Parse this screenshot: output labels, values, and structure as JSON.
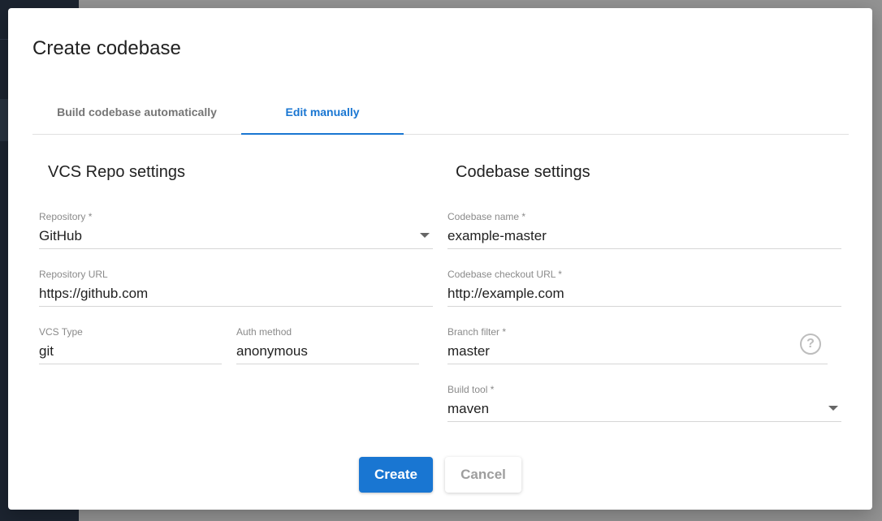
{
  "dialog": {
    "title": "Create codebase",
    "tabs": [
      {
        "label": "Build codebase automatically",
        "active": false
      },
      {
        "label": "Edit manually",
        "active": true
      }
    ],
    "vcs": {
      "heading": "VCS Repo settings",
      "repository": {
        "label": "Repository *",
        "value": "GitHub"
      },
      "repository_url": {
        "label": "Repository URL",
        "value": "https://github.com"
      },
      "vcs_type": {
        "label": "VCS Type",
        "value": "git"
      },
      "auth_method": {
        "label": "Auth method",
        "value": "anonymous"
      }
    },
    "codebase": {
      "heading": "Codebase settings",
      "name": {
        "label": "Codebase name *",
        "value": "example-master"
      },
      "checkout_url": {
        "label": "Codebase checkout URL *",
        "value": "http://example.com"
      },
      "branch_filter": {
        "label": "Branch filter *",
        "value": "master",
        "help_glyph": "?"
      },
      "build_tool": {
        "label": "Build tool *",
        "value": "maven"
      }
    },
    "buttons": {
      "create": "Create",
      "cancel": "Cancel"
    },
    "colors": {
      "accent": "#1976d2",
      "overlay": "#8f8f8f",
      "sidebar": "#1c2430"
    }
  }
}
